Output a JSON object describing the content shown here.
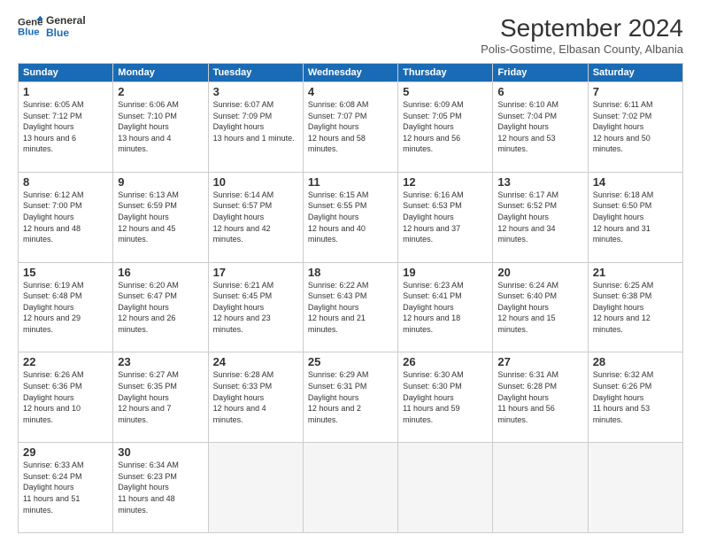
{
  "logo": {
    "line1": "General",
    "line2": "Blue"
  },
  "title": "September 2024",
  "location": "Polis-Gostime, Elbasan County, Albania",
  "days_header": [
    "Sunday",
    "Monday",
    "Tuesday",
    "Wednesday",
    "Thursday",
    "Friday",
    "Saturday"
  ],
  "weeks": [
    [
      {
        "num": "1",
        "sunrise": "Sunrise: 6:05 AM",
        "sunset": "Sunset: 7:12 PM",
        "daylight": "Daylight: 13 hours and 6 minutes."
      },
      {
        "num": "2",
        "sunrise": "Sunrise: 6:06 AM",
        "sunset": "Sunset: 7:10 PM",
        "daylight": "Daylight: 13 hours and 4 minutes."
      },
      {
        "num": "3",
        "sunrise": "Sunrise: 6:07 AM",
        "sunset": "Sunset: 7:09 PM",
        "daylight": "Daylight: 13 hours and 1 minute."
      },
      {
        "num": "4",
        "sunrise": "Sunrise: 6:08 AM",
        "sunset": "Sunset: 7:07 PM",
        "daylight": "Daylight: 12 hours and 58 minutes."
      },
      {
        "num": "5",
        "sunrise": "Sunrise: 6:09 AM",
        "sunset": "Sunset: 7:05 PM",
        "daylight": "Daylight: 12 hours and 56 minutes."
      },
      {
        "num": "6",
        "sunrise": "Sunrise: 6:10 AM",
        "sunset": "Sunset: 7:04 PM",
        "daylight": "Daylight: 12 hours and 53 minutes."
      },
      {
        "num": "7",
        "sunrise": "Sunrise: 6:11 AM",
        "sunset": "Sunset: 7:02 PM",
        "daylight": "Daylight: 12 hours and 50 minutes."
      }
    ],
    [
      {
        "num": "8",
        "sunrise": "Sunrise: 6:12 AM",
        "sunset": "Sunset: 7:00 PM",
        "daylight": "Daylight: 12 hours and 48 minutes."
      },
      {
        "num": "9",
        "sunrise": "Sunrise: 6:13 AM",
        "sunset": "Sunset: 6:59 PM",
        "daylight": "Daylight: 12 hours and 45 minutes."
      },
      {
        "num": "10",
        "sunrise": "Sunrise: 6:14 AM",
        "sunset": "Sunset: 6:57 PM",
        "daylight": "Daylight: 12 hours and 42 minutes."
      },
      {
        "num": "11",
        "sunrise": "Sunrise: 6:15 AM",
        "sunset": "Sunset: 6:55 PM",
        "daylight": "Daylight: 12 hours and 40 minutes."
      },
      {
        "num": "12",
        "sunrise": "Sunrise: 6:16 AM",
        "sunset": "Sunset: 6:53 PM",
        "daylight": "Daylight: 12 hours and 37 minutes."
      },
      {
        "num": "13",
        "sunrise": "Sunrise: 6:17 AM",
        "sunset": "Sunset: 6:52 PM",
        "daylight": "Daylight: 12 hours and 34 minutes."
      },
      {
        "num": "14",
        "sunrise": "Sunrise: 6:18 AM",
        "sunset": "Sunset: 6:50 PM",
        "daylight": "Daylight: 12 hours and 31 minutes."
      }
    ],
    [
      {
        "num": "15",
        "sunrise": "Sunrise: 6:19 AM",
        "sunset": "Sunset: 6:48 PM",
        "daylight": "Daylight: 12 hours and 29 minutes."
      },
      {
        "num": "16",
        "sunrise": "Sunrise: 6:20 AM",
        "sunset": "Sunset: 6:47 PM",
        "daylight": "Daylight: 12 hours and 26 minutes."
      },
      {
        "num": "17",
        "sunrise": "Sunrise: 6:21 AM",
        "sunset": "Sunset: 6:45 PM",
        "daylight": "Daylight: 12 hours and 23 minutes."
      },
      {
        "num": "18",
        "sunrise": "Sunrise: 6:22 AM",
        "sunset": "Sunset: 6:43 PM",
        "daylight": "Daylight: 12 hours and 21 minutes."
      },
      {
        "num": "19",
        "sunrise": "Sunrise: 6:23 AM",
        "sunset": "Sunset: 6:41 PM",
        "daylight": "Daylight: 12 hours and 18 minutes."
      },
      {
        "num": "20",
        "sunrise": "Sunrise: 6:24 AM",
        "sunset": "Sunset: 6:40 PM",
        "daylight": "Daylight: 12 hours and 15 minutes."
      },
      {
        "num": "21",
        "sunrise": "Sunrise: 6:25 AM",
        "sunset": "Sunset: 6:38 PM",
        "daylight": "Daylight: 12 hours and 12 minutes."
      }
    ],
    [
      {
        "num": "22",
        "sunrise": "Sunrise: 6:26 AM",
        "sunset": "Sunset: 6:36 PM",
        "daylight": "Daylight: 12 hours and 10 minutes."
      },
      {
        "num": "23",
        "sunrise": "Sunrise: 6:27 AM",
        "sunset": "Sunset: 6:35 PM",
        "daylight": "Daylight: 12 hours and 7 minutes."
      },
      {
        "num": "24",
        "sunrise": "Sunrise: 6:28 AM",
        "sunset": "Sunset: 6:33 PM",
        "daylight": "Daylight: 12 hours and 4 minutes."
      },
      {
        "num": "25",
        "sunrise": "Sunrise: 6:29 AM",
        "sunset": "Sunset: 6:31 PM",
        "daylight": "Daylight: 12 hours and 2 minutes."
      },
      {
        "num": "26",
        "sunrise": "Sunrise: 6:30 AM",
        "sunset": "Sunset: 6:30 PM",
        "daylight": "Daylight: 11 hours and 59 minutes."
      },
      {
        "num": "27",
        "sunrise": "Sunrise: 6:31 AM",
        "sunset": "Sunset: 6:28 PM",
        "daylight": "Daylight: 11 hours and 56 minutes."
      },
      {
        "num": "28",
        "sunrise": "Sunrise: 6:32 AM",
        "sunset": "Sunset: 6:26 PM",
        "daylight": "Daylight: 11 hours and 53 minutes."
      }
    ],
    [
      {
        "num": "29",
        "sunrise": "Sunrise: 6:33 AM",
        "sunset": "Sunset: 6:24 PM",
        "daylight": "Daylight: 11 hours and 51 minutes."
      },
      {
        "num": "30",
        "sunrise": "Sunrise: 6:34 AM",
        "sunset": "Sunset: 6:23 PM",
        "daylight": "Daylight: 11 hours and 48 minutes."
      },
      {
        "num": "",
        "sunrise": "",
        "sunset": "",
        "daylight": ""
      },
      {
        "num": "",
        "sunrise": "",
        "sunset": "",
        "daylight": ""
      },
      {
        "num": "",
        "sunrise": "",
        "sunset": "",
        "daylight": ""
      },
      {
        "num": "",
        "sunrise": "",
        "sunset": "",
        "daylight": ""
      },
      {
        "num": "",
        "sunrise": "",
        "sunset": "",
        "daylight": ""
      }
    ]
  ]
}
